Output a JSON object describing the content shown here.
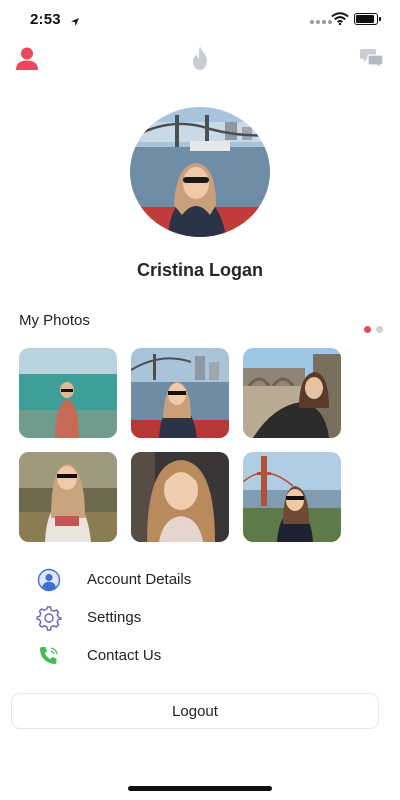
{
  "status_bar": {
    "time": "2:53"
  },
  "profile": {
    "name": "Cristina Logan"
  },
  "photos_section": {
    "title": "My Photos",
    "page_count": 2,
    "current_page": 1
  },
  "menu": {
    "items": [
      {
        "label": "Account Details",
        "icon": "account-icon"
      },
      {
        "label": "Settings",
        "icon": "gear-icon"
      },
      {
        "label": "Contact Us",
        "icon": "phone-icon"
      }
    ]
  },
  "logout": {
    "label": "Logout"
  },
  "colors": {
    "accent": "#e8495b",
    "nav_gray": "#c9ccd2",
    "account_blue": "#3f6fcf",
    "settings_purple": "#6c62b7",
    "contact_green": "#3cbf5a",
    "pager_active": "#e8495b",
    "pager_inactive": "#d0d0d0"
  }
}
